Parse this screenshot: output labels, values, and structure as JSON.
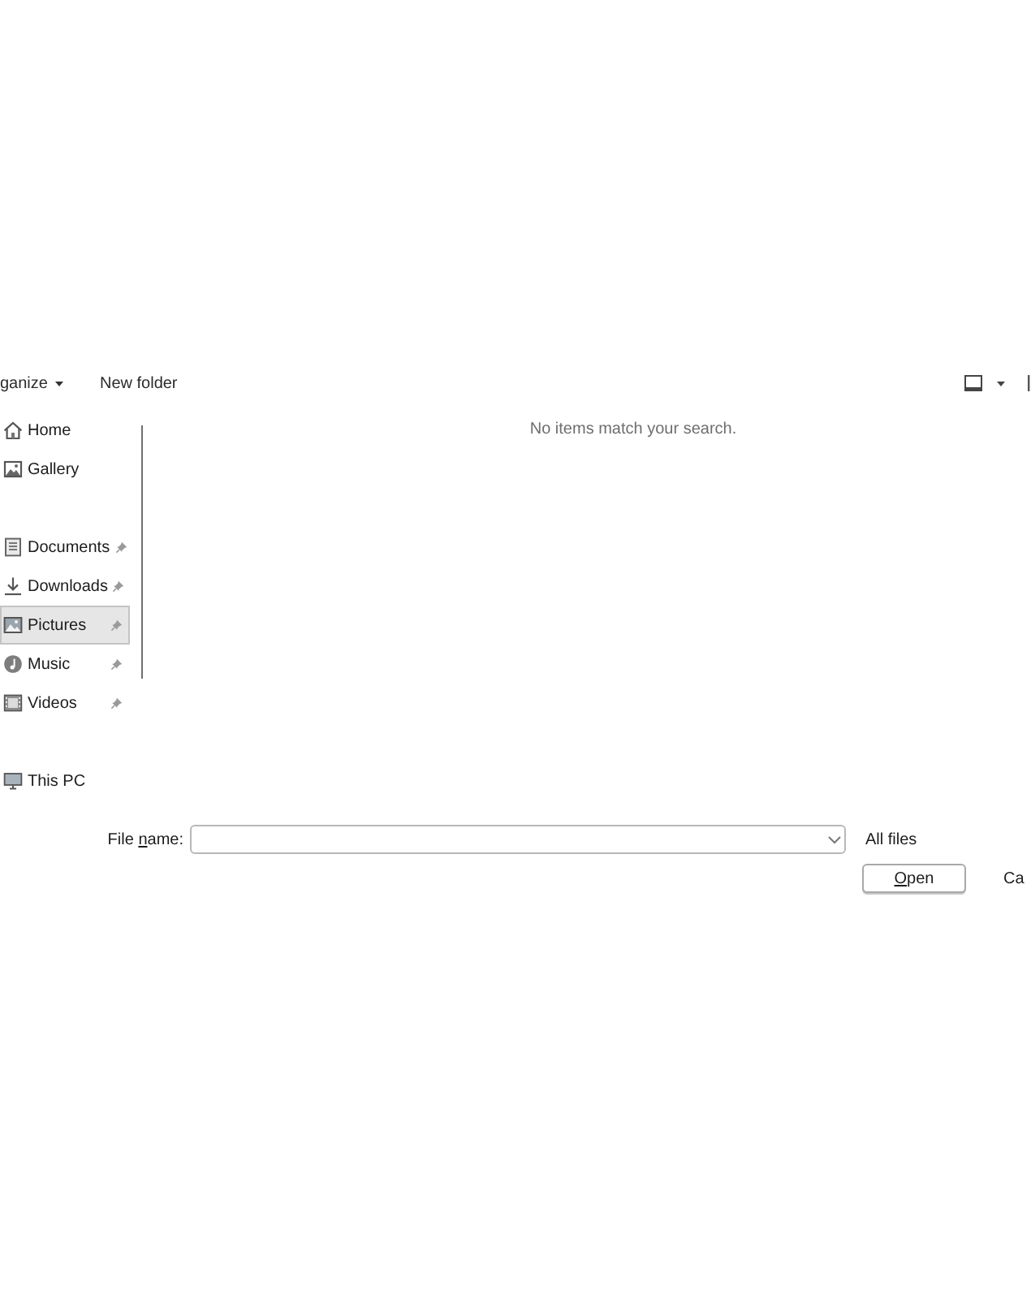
{
  "toolbar": {
    "organize_button": {
      "label": "ganize"
    },
    "new_folder_button": {
      "label": "New folder"
    }
  },
  "sidebar": {
    "sections": [
      {
        "items": [
          {
            "kind": "home",
            "label": "Home",
            "pinned": false,
            "selected": false
          },
          {
            "kind": "gallery",
            "label": "Gallery",
            "pinned": false,
            "selected": false
          }
        ]
      },
      {
        "items": [
          {
            "kind": "documents",
            "label": "Documents",
            "pinned": true,
            "selected": false
          },
          {
            "kind": "downloads",
            "label": "Downloads",
            "pinned": true,
            "selected": false
          },
          {
            "kind": "pictures",
            "label": "Pictures",
            "pinned": true,
            "selected": true
          },
          {
            "kind": "music",
            "label": "Music",
            "pinned": true,
            "selected": false
          },
          {
            "kind": "videos",
            "label": "Videos",
            "pinned": true,
            "selected": false
          }
        ]
      },
      {
        "items": [
          {
            "kind": "this_pc",
            "label": "This PC",
            "pinned": false,
            "selected": false
          }
        ]
      }
    ]
  },
  "content": {
    "empty_message": "No items match your search."
  },
  "footer": {
    "file_name_label": {
      "before": "File ",
      "key": "n",
      "after": "ame:"
    },
    "file_type_filter": "All files",
    "buttons": [
      {
        "kind": "default",
        "label": {
          "key": "O",
          "after": "pen"
        }
      },
      {
        "kind": "plain",
        "label": "Ca"
      }
    ]
  }
}
